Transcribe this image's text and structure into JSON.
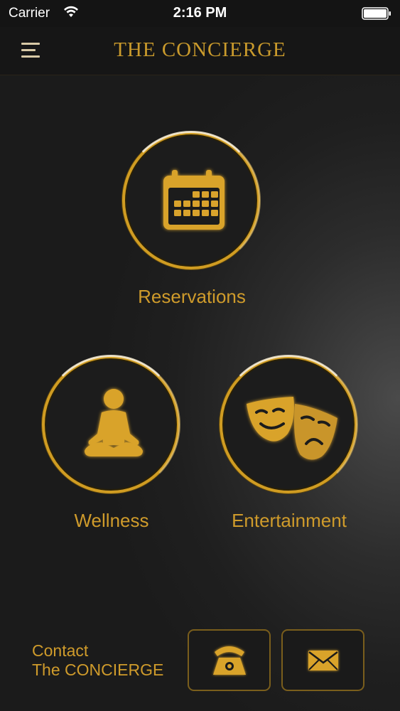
{
  "status_bar": {
    "carrier": "Carrier",
    "time": "2:16 PM"
  },
  "header": {
    "title": "THE CONCIERGE"
  },
  "tiles": [
    {
      "label": "Reservations",
      "icon": "calendar-icon"
    },
    {
      "label": "Wellness",
      "icon": "meditation-icon"
    },
    {
      "label": "Entertainment",
      "icon": "theater-masks-icon"
    }
  ],
  "contact": {
    "line1": "Contact",
    "line2": "The CONCIERGE",
    "buttons": [
      {
        "icon": "telephone-icon"
      },
      {
        "icon": "envelope-icon"
      }
    ]
  },
  "colors": {
    "gold": "#cf9b2b",
    "background": "#1e1e1e",
    "ring": "#d09c22"
  }
}
